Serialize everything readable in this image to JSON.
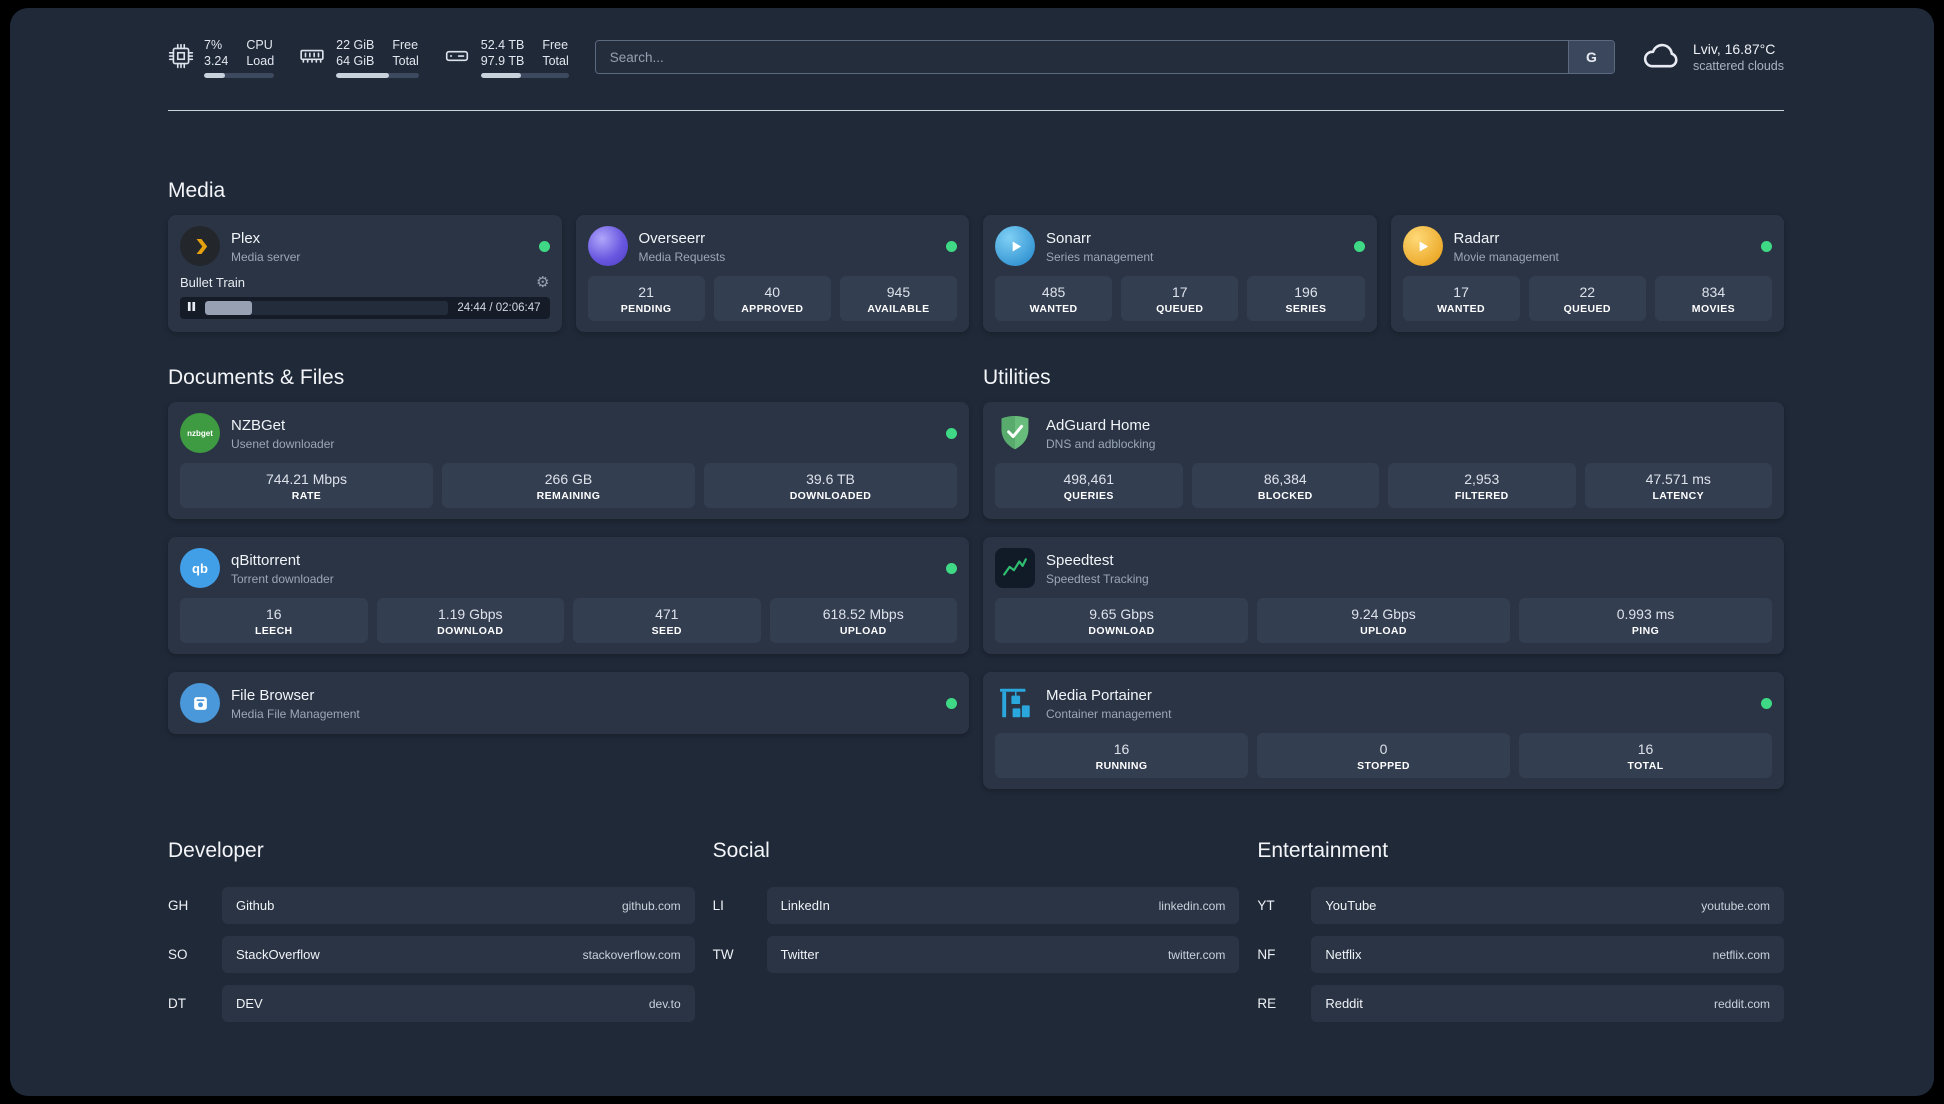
{
  "topbar": {
    "cpu": {
      "value_top": "7%",
      "value_bottom": "3.24",
      "label_top": "CPU",
      "label_bottom": "Load",
      "percent": 30
    },
    "ram": {
      "value_top": "22 GiB",
      "value_bottom": "64 GiB",
      "label_top": "Free",
      "label_bottom": "Total",
      "percent": 64
    },
    "disk": {
      "value_top": "52.4 TB",
      "value_bottom": "97.9 TB",
      "label_top": "Free",
      "label_bottom": "Total",
      "percent": 46
    },
    "search": {
      "placeholder": "Search...",
      "button_label": "G"
    },
    "weather": {
      "location": "Lviv, 16.87°C",
      "condition": "scattered clouds"
    }
  },
  "media": {
    "title": "Media",
    "plex": {
      "name": "Plex",
      "subtitle": "Media server",
      "now_playing": "Bullet Train",
      "time": "24:44 / 02:06:47",
      "progress_percent": 19.5
    },
    "overseerr": {
      "name": "Overseerr",
      "subtitle": "Media Requests",
      "stats": [
        {
          "value": "21",
          "label": "PENDING"
        },
        {
          "value": "40",
          "label": "APPROVED"
        },
        {
          "value": "945",
          "label": "AVAILABLE"
        }
      ]
    },
    "sonarr": {
      "name": "Sonarr",
      "subtitle": "Series management",
      "stats": [
        {
          "value": "485",
          "label": "WANTED"
        },
        {
          "value": "17",
          "label": "QUEUED"
        },
        {
          "value": "196",
          "label": "SERIES"
        }
      ]
    },
    "radarr": {
      "name": "Radarr",
      "subtitle": "Movie management",
      "stats": [
        {
          "value": "17",
          "label": "WANTED"
        },
        {
          "value": "22",
          "label": "QUEUED"
        },
        {
          "value": "834",
          "label": "MOVIES"
        }
      ]
    }
  },
  "documents": {
    "title": "Documents & Files",
    "nzbget": {
      "name": "NZBGet",
      "subtitle": "Usenet downloader",
      "icon_text": "nzbget",
      "stats": [
        {
          "value": "744.21 Mbps",
          "label": "RATE"
        },
        {
          "value": "266 GB",
          "label": "REMAINING"
        },
        {
          "value": "39.6 TB",
          "label": "DOWNLOADED"
        }
      ]
    },
    "qbittorrent": {
      "name": "qBittorrent",
      "subtitle": "Torrent downloader",
      "icon_text": "qb",
      "stats": [
        {
          "value": "16",
          "label": "LEECH"
        },
        {
          "value": "1.19 Gbps",
          "label": "DOWNLOAD"
        },
        {
          "value": "471",
          "label": "SEED"
        },
        {
          "value": "618.52 Mbps",
          "label": "UPLOAD"
        }
      ]
    },
    "filebrowser": {
      "name": "File Browser",
      "subtitle": "Media File Management"
    }
  },
  "utilities": {
    "title": "Utilities",
    "adguard": {
      "name": "AdGuard Home",
      "subtitle": "DNS and adblocking",
      "stats": [
        {
          "value": "498,461",
          "label": "QUERIES"
        },
        {
          "value": "86,384",
          "label": "BLOCKED"
        },
        {
          "value": "2,953",
          "label": "FILTERED"
        },
        {
          "value": "47.571 ms",
          "label": "LATENCY"
        }
      ]
    },
    "speedtest": {
      "name": "Speedtest",
      "subtitle": "Speedtest Tracking",
      "stats": [
        {
          "value": "9.65 Gbps",
          "label": "DOWNLOAD"
        },
        {
          "value": "9.24 Gbps",
          "label": "UPLOAD"
        },
        {
          "value": "0.993 ms",
          "label": "PING"
        }
      ]
    },
    "portainer": {
      "name": "Media Portainer",
      "subtitle": "Container management",
      "stats": [
        {
          "value": "16",
          "label": "RUNNING"
        },
        {
          "value": "0",
          "label": "STOPPED"
        },
        {
          "value": "16",
          "label": "TOTAL"
        }
      ]
    }
  },
  "bookmarks": {
    "developer": {
      "title": "Developer",
      "items": [
        {
          "abbr": "GH",
          "name": "Github",
          "domain": "github.com"
        },
        {
          "abbr": "SO",
          "name": "StackOverflow",
          "domain": "stackoverflow.com"
        },
        {
          "abbr": "DT",
          "name": "DEV",
          "domain": "dev.to"
        }
      ]
    },
    "social": {
      "title": "Social",
      "items": [
        {
          "abbr": "LI",
          "name": "LinkedIn",
          "domain": "linkedin.com"
        },
        {
          "abbr": "TW",
          "name": "Twitter",
          "domain": "twitter.com"
        }
      ]
    },
    "entertainment": {
      "title": "Entertainment",
      "items": [
        {
          "abbr": "YT",
          "name": "YouTube",
          "domain": "youtube.com"
        },
        {
          "abbr": "NF",
          "name": "Netflix",
          "domain": "netflix.com"
        },
        {
          "abbr": "RE",
          "name": "Reddit",
          "domain": "reddit.com"
        }
      ]
    }
  },
  "colors": {
    "app_background": "#202938",
    "card_background": "#2a3444",
    "tile_background": "#333e51",
    "strip_background": "#151c28",
    "search_border": "#5b6981",
    "search_button_background": "#3b475c",
    "status_online": "#3fd884",
    "plex": "#e5a00d",
    "sonarr": "#33a4e5",
    "radarr": "#f0b428",
    "nzbget": "#3e9b41",
    "qbittorrent": "#419fe8",
    "filebrowser": "#4a97d9",
    "adguard": "#68bd7c",
    "speedtest": "#2fbf71",
    "portainer": "#2aa8de"
  }
}
